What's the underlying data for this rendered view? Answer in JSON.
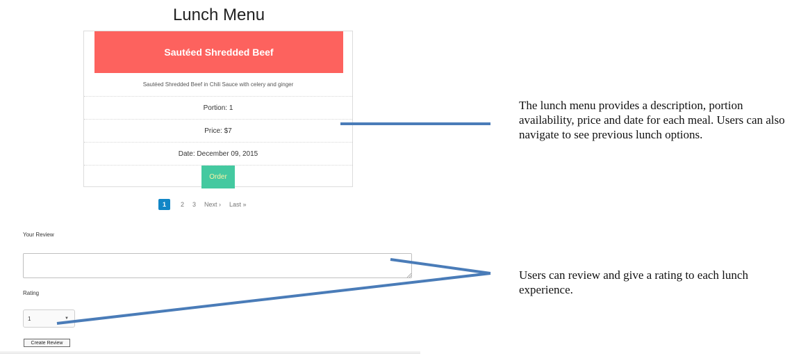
{
  "page": {
    "title": "Lunch Menu"
  },
  "meal": {
    "name": "Sautéed Shredded Beef",
    "description": "Sautéed Shredded Beef in Chili Sauce with celery and ginger",
    "portion": "Portion: 1",
    "price": "Price: $7",
    "date": "Date: December 09, 2015",
    "order_label": "Order"
  },
  "pagination": {
    "pages": [
      "1",
      "2",
      "3"
    ],
    "active_page": "1",
    "next": "Next ›",
    "last": "Last »"
  },
  "review": {
    "label": "Your Review",
    "value": "",
    "rating_label": "Rating",
    "rating_value": "1",
    "submit_label": "Create Review"
  },
  "annotations": {
    "menu_note": "The lunch menu provides a description, portion availability, price and date for each meal. Users can also navigate to see previous lunch options.",
    "review_note": "Users can review and give a rating to each lunch experience."
  },
  "colors": {
    "header": "#fd625e",
    "order_button": "#44c9a0",
    "active_page": "#1186c6",
    "connector_line": "#4a7cb8"
  }
}
